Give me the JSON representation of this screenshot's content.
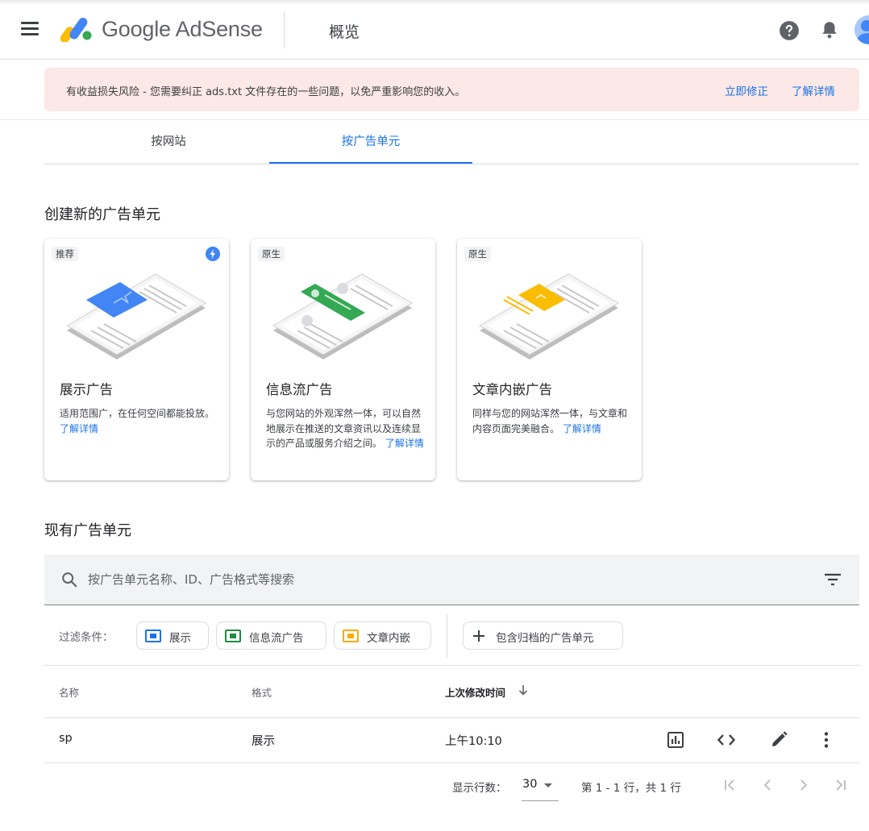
{
  "header": {
    "menu_icon": "hamburger-menu-icon",
    "logo_text": "Google AdSense",
    "page_title": "概览",
    "help_icon": "help-circle-icon",
    "notification_icon": "bell-icon"
  },
  "alert": {
    "message": "有收益损失风险 - 您需要纠正 ads.txt 文件存在的一些问题，以免严重影响您的收入。",
    "fix_label": "立即修正",
    "learn_more_label": "了解详情",
    "background_color": "#fce8e6"
  },
  "tabs": [
    {
      "label": "按网站",
      "active": false
    },
    {
      "label": "按广告单元",
      "active": true
    }
  ],
  "create_section": {
    "heading": "创建新的广告单元",
    "cards": [
      {
        "tag": "推荐",
        "badge_icon": "lightning-bolt-icon",
        "title": "展示广告",
        "description": "适用范围广，在任何空间都能投放。",
        "link": "了解详情",
        "accent_color": "#4285f4"
      },
      {
        "tag": "原生",
        "title": "信息流广告",
        "description": "与您网站的外观浑然一体，可以自然地展示在推送的文章资讯以及连续显示的产品或服务介绍之间。",
        "link": "了解详情",
        "accent_color": "#34a853"
      },
      {
        "tag": "原生",
        "title": "文章内嵌广告",
        "description": "同样与您的网站浑然一体，与文章和内容页面完美融合。",
        "link": "了解详情",
        "accent_color": "#fbbc04"
      }
    ]
  },
  "existing_section": {
    "heading": "现有广告单元",
    "search": {
      "placeholder": "按广告单元名称、ID、广告格式等搜索",
      "value": ""
    },
    "filters": {
      "label": "过滤条件：",
      "chips": [
        {
          "label": "展示",
          "color": "#1a73e8"
        },
        {
          "label": "信息流广告",
          "color": "#1e8e3e"
        },
        {
          "label": "文章内嵌",
          "color": "#f9ab00"
        }
      ],
      "archived_chip": "包含归档的广告单元"
    },
    "table": {
      "columns": [
        "名称",
        "格式",
        "上次修改时间"
      ],
      "sort_icon": "arrow-down-icon",
      "rows": [
        {
          "name": "sp",
          "format": "展示",
          "modified": "上午10:10"
        }
      ],
      "row_actions": [
        "bar-chart-icon",
        "code-icon",
        "pencil-icon",
        "more-vert-icon"
      ]
    },
    "pagination": {
      "rows_label": "显示行数：",
      "rows_per_page": "30",
      "range_text": "第 1 - 1 行，共 1 行"
    }
  }
}
